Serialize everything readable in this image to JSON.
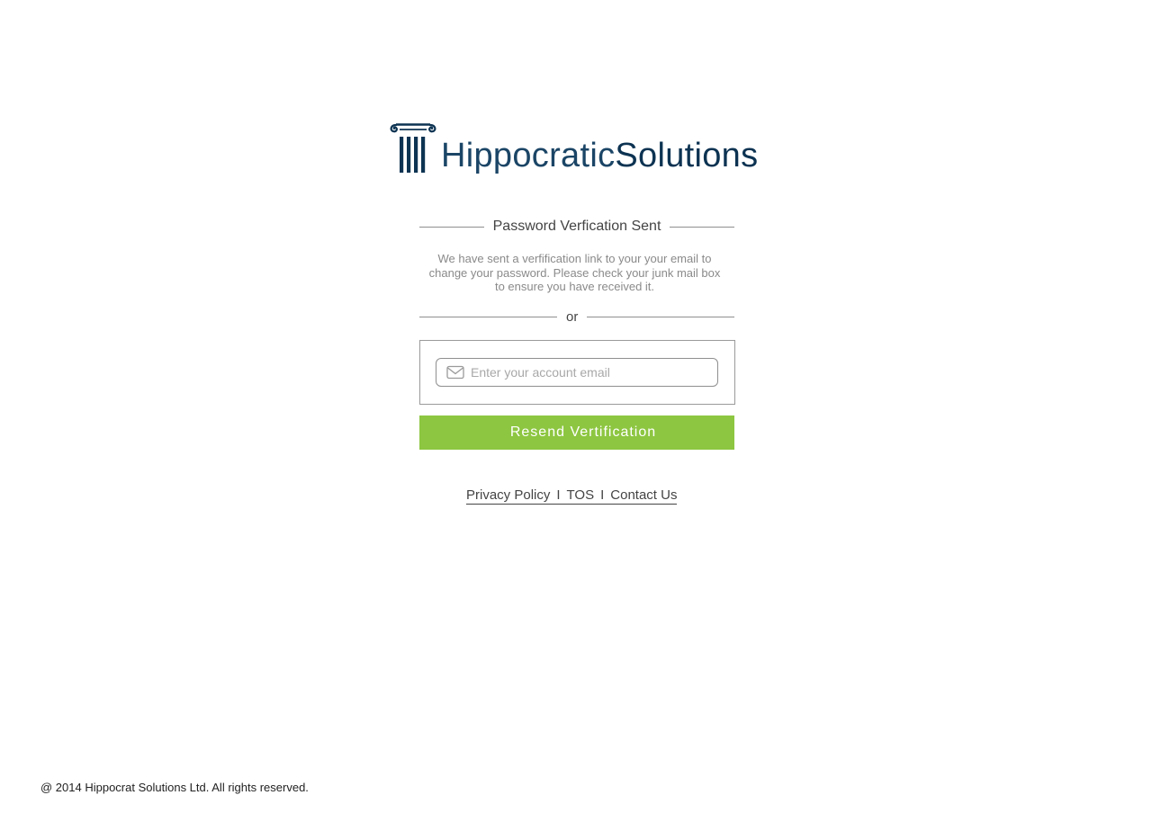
{
  "brand": {
    "name_light": "Hippocratic",
    "name_bold": "Solutions",
    "color": "#0d3352"
  },
  "card": {
    "title": "Password Verfication Sent",
    "message": "We have sent a verfification link to your your email to change your password. Please check your junk mail box to ensure you have received it.",
    "separator": "or"
  },
  "form": {
    "email_placeholder": "Enter your account email",
    "email_value": "",
    "email_icon": "envelope-icon",
    "submit_label": "Resend Vertification",
    "submit_color": "#8dc641"
  },
  "links": {
    "privacy": "Privacy Policy",
    "sep1": "I",
    "tos": "TOS",
    "sep2": "I",
    "contact": "Contact Us"
  },
  "footer": {
    "copyright": "@ 2014 Hippocrat Solutions Ltd. All rights reserved."
  }
}
